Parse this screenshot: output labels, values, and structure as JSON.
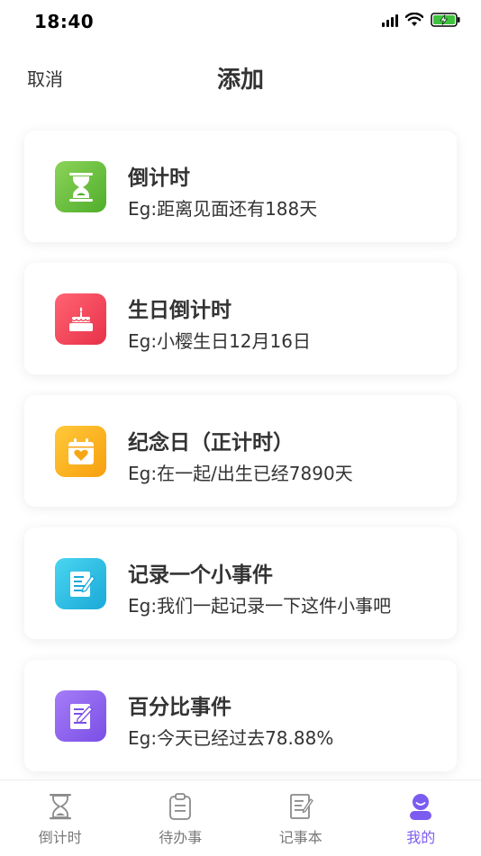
{
  "status_bar": {
    "time": "18:40"
  },
  "nav": {
    "cancel_label": "取消",
    "title": "添加"
  },
  "cards": [
    {
      "title": "倒计时",
      "desc": "Eg:距离见面还有188天",
      "icon": "hourglass-icon",
      "color": "#62bb3d"
    },
    {
      "title": "生日倒计时",
      "desc": "Eg:小樱生日12月16日",
      "icon": "birthday-cake-icon",
      "color": "#f0445a"
    },
    {
      "title": "纪念日（正计时）",
      "desc": "Eg:在一起/出生已经7890天",
      "icon": "calendar-heart-icon",
      "color": "#fbb01c"
    },
    {
      "title": "记录一个小事件",
      "desc": "Eg:我们一起记录一下这件小事吧",
      "icon": "notepad-pencil-icon",
      "color": "#2dc0e6"
    },
    {
      "title": "百分比事件",
      "desc": "Eg:今天已经过去78.88%",
      "icon": "document-pencil-icon",
      "color": "#8b62ee"
    }
  ],
  "tabs": [
    {
      "label": "倒计时",
      "icon": "hourglass-icon",
      "active": false
    },
    {
      "label": "待办事",
      "icon": "clipboard-icon",
      "active": false
    },
    {
      "label": "记事本",
      "icon": "notebook-icon",
      "active": false
    },
    {
      "label": "我的",
      "icon": "user-icon",
      "active": true
    }
  ],
  "colors": {
    "accent": "#7b5cf0",
    "battery": "#3ec33e"
  }
}
